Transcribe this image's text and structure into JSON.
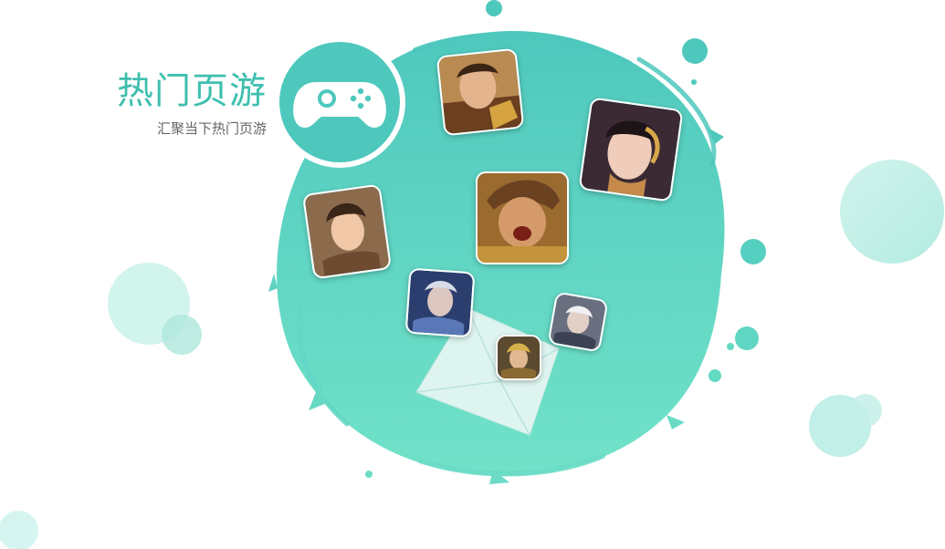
{
  "heading": {
    "title": "热门页游",
    "subtitle": "汇聚当下热门页游"
  },
  "badge": {
    "icon": "gamepad-icon"
  },
  "colors": {
    "accent": "#3fbfae",
    "splash_top": "#4ec8bd",
    "splash_bottom": "#70e0c8",
    "bubble": "#b8ede3"
  },
  "games": [
    {
      "name": "warrior-golden-armor"
    },
    {
      "name": "sorceress-gold-tiara"
    },
    {
      "name": "roaring-warrior"
    },
    {
      "name": "lady-warrior"
    },
    {
      "name": "blue-armored-knight"
    },
    {
      "name": "silver-haired-knight"
    },
    {
      "name": "golden-helm-warrior"
    }
  ]
}
